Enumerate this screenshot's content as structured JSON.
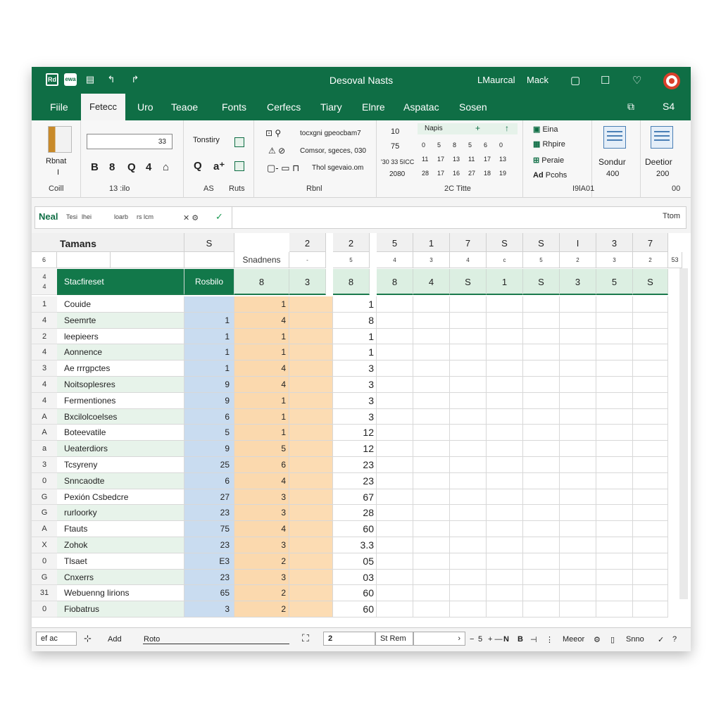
{
  "titlebar": {
    "icons": [
      "grid-icon",
      "save-icon",
      "document-icon",
      "undo-icon",
      "redo-icon"
    ],
    "icon_glyphs": [
      "Rd",
      "ewa",
      "▤",
      "↰",
      "↱"
    ],
    "title": "Desoval Nasts",
    "user": "LMaurcal",
    "user2": "Mack",
    "right_glyphs": [
      "▢",
      "☐",
      "♡"
    ]
  },
  "tabs": {
    "items": [
      "Fiile",
      "Fetecc",
      "Uro",
      "Teaoe",
      "Fonts",
      "Cerfecs",
      "Tiary",
      "Elnre",
      "Aspatac",
      "Sosen"
    ],
    "active_index": 1,
    "right_label": "S4",
    "right_icon_glyph": "⧉"
  },
  "ribbon": {
    "paste_label": "Rbnat",
    "paste_sub": "I",
    "group1_label": "Coill",
    "font_size_value": "33",
    "font_buttons": [
      "B",
      "8",
      "Q",
      "4",
      "⌂"
    ],
    "font_group_label": "13 :ilo",
    "align_label": "Tonstiry",
    "align_buttons": [
      "Q",
      "a⁺"
    ],
    "align_group_a": "AS",
    "align_group_b": "Ruts",
    "num_line1": "tocxgni gpeocbam7",
    "num_line2": "Comsor, sgeces, 030",
    "num_line3": "Thol sgevaio.om",
    "num_group_label": "Rbnl",
    "cal_left": [
      "10",
      "75",
      "'30 33 5ICC",
      "2080"
    ],
    "cal_header": "Napis",
    "cal_rows": [
      [
        "0",
        "5",
        "8",
        "5",
        "6",
        "0"
      ],
      [
        "11",
        "17",
        "13",
        "11",
        "17",
        "13"
      ],
      [
        "28",
        "17",
        "16",
        "27",
        "18",
        "19"
      ]
    ],
    "cal_group_label": "2C Titte",
    "styles": [
      "Eina",
      "Rhpire",
      "Peraie",
      "Pcohs"
    ],
    "styles_group_label": "I9lA01",
    "sondur_label": "Sondur",
    "sondur_value": "400",
    "deetior_label": "Deetior",
    "deetior_value": "200",
    "right_group_label": "00"
  },
  "formula": {
    "name": "Neal",
    "tiny1": "Tesi",
    "tiny2": "lhei",
    "tiny3": "loarb",
    "tiny4": "rs lcm",
    "right_text": "Ttom"
  },
  "grid": {
    "title_cell": "Tamans",
    "title_cell2": "S",
    "col_heads": [
      "2",
      "2",
      "5",
      "1",
      "7",
      "S",
      "S",
      "I",
      "3",
      "7"
    ],
    "sub_left": "6",
    "sub_label": "Snadnens",
    "sub_heads": [
      "-",
      "5",
      "4",
      "3",
      "4",
      "c",
      "5",
      "2",
      "3",
      "2"
    ],
    "sub_right": "53",
    "header_row": {
      "row_nums": [
        "4",
        "4"
      ],
      "name": "Stacfireset",
      "b": "Rosbilo",
      "cols": [
        "8",
        "3",
        "8",
        "8",
        "4",
        "S",
        "1",
        "S",
        "3",
        "5",
        "S"
      ]
    },
    "rows": [
      {
        "n": "1",
        "name": "Couide",
        "b": "",
        "c": "1",
        "e": "1"
      },
      {
        "n": "4",
        "name": "Seemrte",
        "b": "1",
        "c": "4",
        "e": "8"
      },
      {
        "n": "2",
        "name": "leepieers",
        "b": "1",
        "c": "1",
        "e": "1"
      },
      {
        "n": "4",
        "name": "Aonnence",
        "b": "1",
        "c": "1",
        "e": "1"
      },
      {
        "n": "3",
        "name": "Ae rrrgpctes",
        "b": "1",
        "c": "4",
        "e": "3"
      },
      {
        "n": "4",
        "name": "Noitsoplesres",
        "b": "9",
        "c": "4",
        "e": "3"
      },
      {
        "n": "4",
        "name": "Fermentiones",
        "b": "9",
        "c": "1",
        "e": "3"
      },
      {
        "n": "A",
        "name": "Bxcilolcoelses",
        "b": "6",
        "c": "1",
        "e": "3"
      },
      {
        "n": "A",
        "name": "Boteevatile",
        "b": "5",
        "c": "1",
        "e": "12"
      },
      {
        "n": "a",
        "name": "Ueaterdiors",
        "b": "9",
        "c": "5",
        "e": "12"
      },
      {
        "n": "3",
        "name": "Tcsyreny",
        "b": "25",
        "c": "6",
        "e": "23"
      },
      {
        "n": "0",
        "name": "Snncaodte",
        "b": "6",
        "c": "4",
        "e": "23"
      },
      {
        "n": "G",
        "name": "Pexión Csbedcre",
        "b": "27",
        "c": "3",
        "e": "67"
      },
      {
        "n": "G",
        "name": "rurloorky",
        "b": "23",
        "c": "3",
        "e": "28"
      },
      {
        "n": "A",
        "name": "Ftauts",
        "b": "75",
        "c": "4",
        "e": "60"
      },
      {
        "n": "X",
        "name": "Zohok",
        "b": "23",
        "c": "3",
        "e": "3.3"
      },
      {
        "n": "0",
        "name": "Tlsaet",
        "b": "E3",
        "c": "2",
        "e": "05"
      },
      {
        "n": "G",
        "name": "Cnxerrs",
        "b": "23",
        "c": "3",
        "e": "03"
      },
      {
        "n": "31",
        "name": "Webuenng lirions",
        "b": "65",
        "c": "2",
        "e": "60"
      },
      {
        "n": "0",
        "name": "Fiobatrus",
        "b": "3",
        "c": "2",
        "e": "60"
      }
    ]
  },
  "statusbar": {
    "sheet": "ef ac",
    "add": "Add",
    "rows": "Roto",
    "page_value": "2",
    "page_label": "St Rem",
    "zoom": "5",
    "mode": "Meeor",
    "view": "Snno"
  },
  "colors": {
    "brand_green": "#0f6e45",
    "header_green": "#dcefe2",
    "col_b_blue": "#c9dcf0",
    "col_c_orange": "#fbd9ae"
  }
}
